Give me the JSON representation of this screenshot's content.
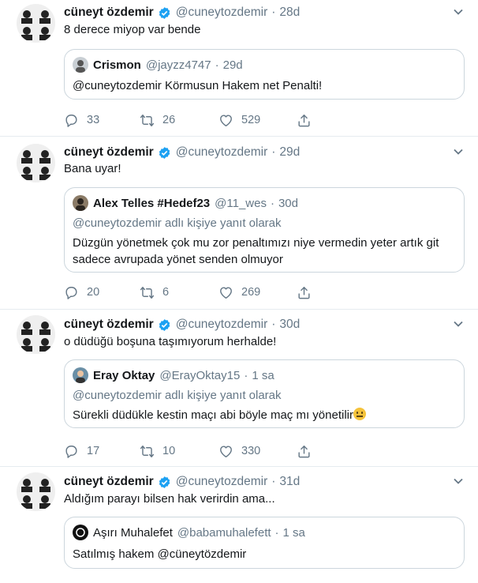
{
  "tweets": [
    {
      "name": "cüneyt özdemir",
      "handle": "@cuneytozdemir",
      "time": "28d",
      "text": "8 derece miyop var bende",
      "quote": {
        "name": "Crismon",
        "handle": "@jayzz4747",
        "time": "29d",
        "reply_to": "",
        "text": "@cuneytozdemir Körmusun Hakem net Penalti!"
      },
      "replies": "33",
      "retweets": "26",
      "likes": "529"
    },
    {
      "name": "cüneyt özdemir",
      "handle": "@cuneytozdemir",
      "time": "29d",
      "text": "Bana uyar!",
      "quote": {
        "name": "Alex Telles #Hedef23",
        "handle": "@11_wes",
        "time": "30d",
        "reply_to": "@cuneytozdemir adlı kişiye yanıt olarak",
        "text": "Düzgün yönetmek çok mu zor penaltımızı niye vermedin yeter artık git sadece avrupada yönet senden olmuyor"
      },
      "replies": "20",
      "retweets": "6",
      "likes": "269"
    },
    {
      "name": "cüneyt özdemir",
      "handle": "@cuneytozdemir",
      "time": "30d",
      "text": "o düdüğü boşuna taşımıyorum herhalde!",
      "quote": {
        "name": "Eray Oktay",
        "handle": "@ErayOktay15",
        "time": "1 sa",
        "reply_to": "@cuneytozdemir adlı kişiye yanıt olarak",
        "text": "Sürekli düdükle kestin maçı abi böyle maç mı yönetilir"
      },
      "replies": "17",
      "retweets": "10",
      "likes": "330"
    },
    {
      "name": "cüneyt özdemir",
      "handle": "@cuneytozdemir",
      "time": "31d",
      "text": "Aldığım parayı bilsen hak verirdin ama...",
      "quote": {
        "name": "Aşırı Muhalefet",
        "handle": "@babamuhalefett",
        "time": "1 sa",
        "reply_to": "",
        "text": "Satılmış hakem @cüneytözdemir"
      }
    }
  ],
  "separator": "·",
  "colors": {
    "brand": "#1da1f2",
    "secondary_text": "#657786",
    "border": "#ccd6dd"
  },
  "icons": [
    "verified-badge-icon",
    "chevron-down-icon",
    "reply-icon",
    "retweet-icon",
    "like-icon",
    "share-icon",
    "neutral-face-emoji-icon"
  ]
}
